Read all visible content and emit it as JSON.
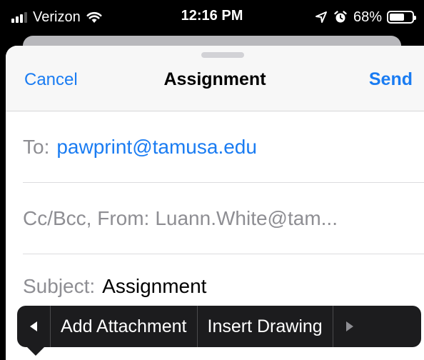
{
  "status_bar": {
    "carrier": "Verizon",
    "time": "12:16 PM",
    "battery_percent": "68%",
    "battery_level": 0.68,
    "icons": [
      "signal-icon",
      "wifi-icon",
      "location-icon",
      "alarm-icon",
      "battery-icon"
    ]
  },
  "nav": {
    "cancel_label": "Cancel",
    "title": "Assignment",
    "send_label": "Send"
  },
  "fields": {
    "to_label": "To:",
    "to_value": "pawprint@tamusa.edu",
    "cc_label": "Cc/Bcc, From:",
    "cc_value": "Luann.White@tam...",
    "subject_label": "Subject:",
    "subject_value": "Assignment"
  },
  "edit_menu": {
    "items": [
      "Add Attachment",
      "Insert Drawing"
    ],
    "icons": [
      "triangle-left-icon",
      "triangle-right-icon"
    ]
  },
  "colors": {
    "accent": "#1a7cf2",
    "label_gray": "#8e8e93",
    "menu_bg": "#1c1c1e"
  }
}
